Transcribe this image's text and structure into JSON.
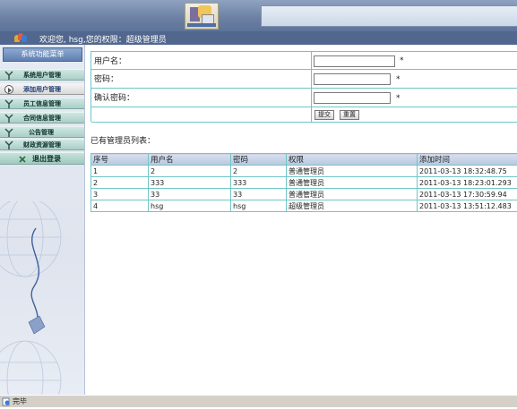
{
  "header": {
    "welcome_text": "欢迎您, hsg,您的权限：超级管理员"
  },
  "sidebar": {
    "title": "系统功能菜单",
    "items": [
      {
        "label": "系统用户管理",
        "icon": "antenna-icon"
      },
      {
        "label": "添加用户管理",
        "icon": "play-circle-icon",
        "active": true
      },
      {
        "label": "员工信息管理",
        "icon": "antenna-icon"
      },
      {
        "label": "合同信息管理",
        "icon": "antenna-icon"
      },
      {
        "label": "公告管理",
        "icon": "antenna-icon"
      },
      {
        "label": "财政资源管理",
        "icon": "antenna-icon"
      }
    ],
    "logout_label": "退出登录"
  },
  "form": {
    "username_label": "用户名：",
    "password_label": "密码：",
    "confirm_label": "确认密码：",
    "required_mark": "*",
    "username_value": "",
    "password_value": "",
    "confirm_value": "",
    "submit_label": "提交",
    "reset_label": "重置"
  },
  "list": {
    "title": "已有管理员列表：",
    "columns": [
      "序号",
      "用户名",
      "密码",
      "权限",
      "添加时间"
    ],
    "rows": [
      [
        "1",
        "2",
        "2",
        "普通管理员",
        "2011-03-13 18:32:48.75"
      ],
      [
        "2",
        "333",
        "333",
        "普通管理员",
        "2011-03-13 18:23:01.293"
      ],
      [
        "3",
        "33",
        "33",
        "普通管理员",
        "2011-03-13 17:30:59.94"
      ],
      [
        "4",
        "hsg",
        "hsg",
        "超级管理员",
        "2011-03-13 13:51:12.483"
      ]
    ]
  },
  "statusbar": {
    "text": "完毕"
  },
  "colors": {
    "banner": "#6b7fa3",
    "welcome_bar": "#52678d",
    "table_border": "#6fc6c6",
    "menu_teal": "#a9cfc7"
  }
}
